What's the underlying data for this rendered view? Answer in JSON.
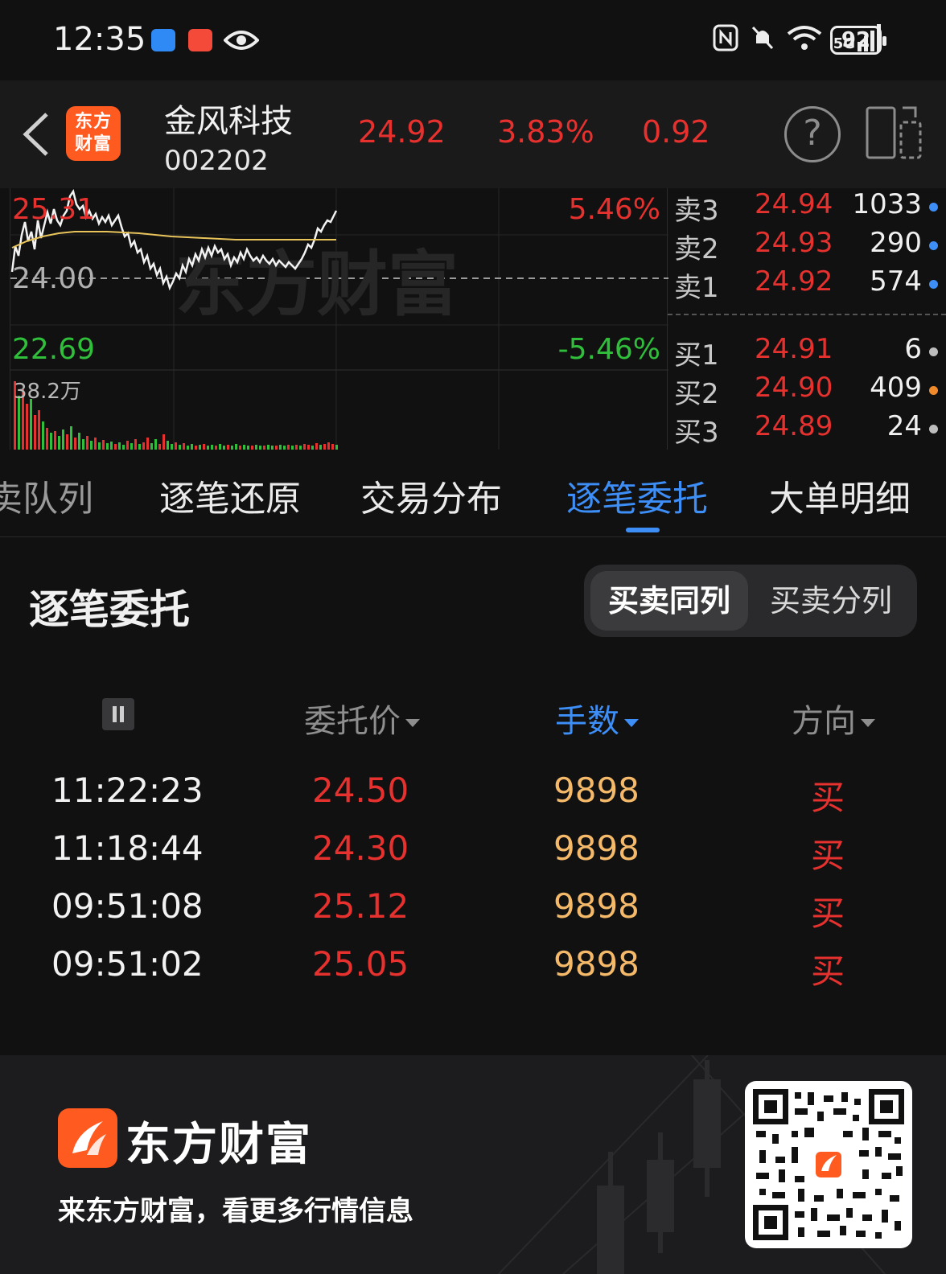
{
  "status_bar": {
    "time": "12:35",
    "network": "5G",
    "battery": "92"
  },
  "header": {
    "logo_text": "东方财富",
    "stock_name": "金风科技",
    "stock_code": "002202",
    "price": "24.92",
    "change_pct": "3.83%",
    "change": "0.92"
  },
  "chart": {
    "high_label": "25.31",
    "prev_close_label": "24.00",
    "low_label": "22.69",
    "up_pct": "5.46%",
    "down_pct": "-5.46%",
    "volume_label": "38.2万",
    "watermark": "东方财富"
  },
  "orderbook": {
    "asks": [
      {
        "label": "卖3",
        "price": "24.94",
        "vol": "1033",
        "dot": "#3d8ef7"
      },
      {
        "label": "卖2",
        "price": "24.93",
        "vol": "290",
        "dot": "#3d8ef7"
      },
      {
        "label": "卖1",
        "price": "24.92",
        "vol": "574",
        "dot": "#3d8ef7"
      }
    ],
    "bids": [
      {
        "label": "买1",
        "price": "24.91",
        "vol": "6",
        "dot": "#bdbdbd"
      },
      {
        "label": "买2",
        "price": "24.90",
        "vol": "409",
        "dot": "#f08a2b"
      },
      {
        "label": "买3",
        "price": "24.89",
        "vol": "24",
        "dot": "#bdbdbd"
      }
    ]
  },
  "tabs": [
    "卖队列",
    "逐笔还原",
    "交易分布",
    "逐笔委托",
    "大单明细"
  ],
  "active_tab": "逐笔委托",
  "section": {
    "title": "逐笔委托",
    "toggle_same": "买卖同列",
    "toggle_split": "买卖分列"
  },
  "table": {
    "headers": {
      "price": "委托价",
      "qty": "手数",
      "dir": "方向"
    },
    "rows": [
      {
        "time": "11:22:23",
        "price": "24.50",
        "qty": "9898",
        "dir": "买"
      },
      {
        "time": "11:18:44",
        "price": "24.30",
        "qty": "9898",
        "dir": "买"
      },
      {
        "time": "09:51:08",
        "price": "25.12",
        "qty": "9898",
        "dir": "买"
      },
      {
        "time": "09:51:02",
        "price": "25.05",
        "qty": "9898",
        "dir": "买"
      }
    ]
  },
  "footer": {
    "brand": "东方财富",
    "slogan": "来东方财富，看更多行情信息"
  },
  "colors": {
    "up": "#e6312e",
    "down": "#2fbf3a",
    "accent": "#3d8ef7",
    "qty": "#f5b96a"
  }
}
